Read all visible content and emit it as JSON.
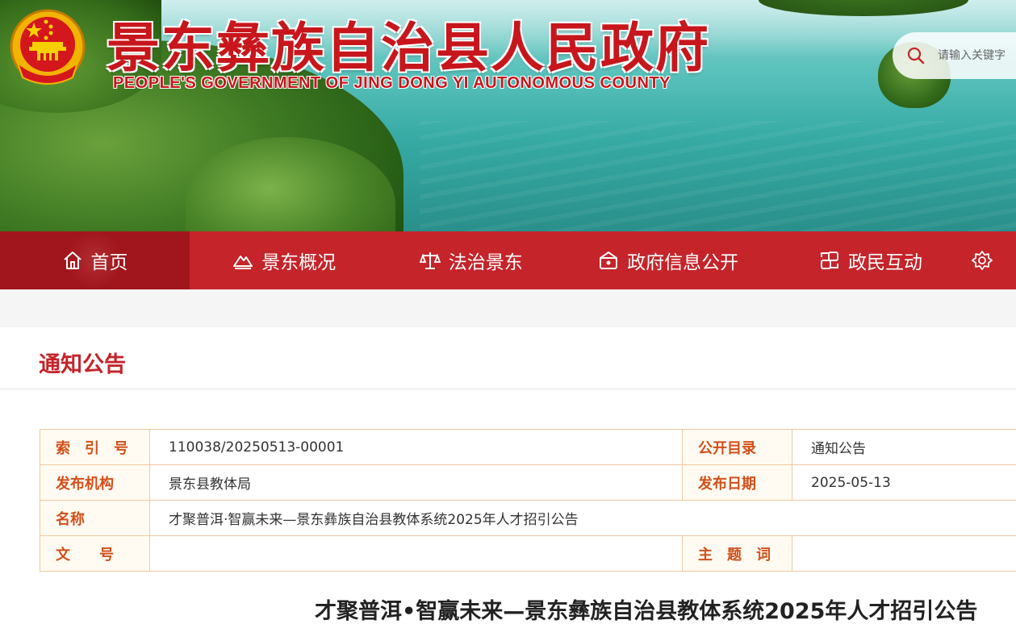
{
  "header": {
    "title": "景东彝族自治县人民政府",
    "subtitle": "PEOPLE'S GOVERNMENT OF JING DONG YI AUTONOMOUS COUNTY",
    "emblem_icon": "national-emblem-icon",
    "search": {
      "placeholder": "请输入关键字",
      "icon": "search-icon"
    }
  },
  "nav": {
    "items": [
      {
        "label": "首页",
        "icon": "home-icon",
        "active": true
      },
      {
        "label": "景东概况",
        "icon": "mountain-icon"
      },
      {
        "label": "法治景东",
        "icon": "scales-icon"
      },
      {
        "label": "政府信息公开",
        "icon": "government-building-icon"
      },
      {
        "label": "政民互动",
        "icon": "interaction-icon"
      },
      {
        "label": "",
        "icon": "settings-icon"
      }
    ]
  },
  "section": {
    "title": "通知公告"
  },
  "meta": {
    "index_label": "索　引　号",
    "index_value": "110038/20250513-00001",
    "catalog_label": "公开目录",
    "catalog_value": "通知公告",
    "issuer_label": "发布机构",
    "issuer_value": "景东县教体局",
    "date_label": "发布日期",
    "date_value": "2025-05-13",
    "name_label": "名称",
    "name_value": "才聚普洱·智赢未来—景东彝族自治县教体系统2025年人才招引公告",
    "docno_label": "文　　号",
    "docno_value": "",
    "keyword_label": "主　题　词",
    "keyword_value": ""
  },
  "article": {
    "title": "才聚普洱•智赢未来—景东彝族自治县教体系统2025年人才招引公告"
  },
  "colors": {
    "primary_red": "#c4242a",
    "nav_active": "#a0161c",
    "label_orange": "#d1501a"
  }
}
